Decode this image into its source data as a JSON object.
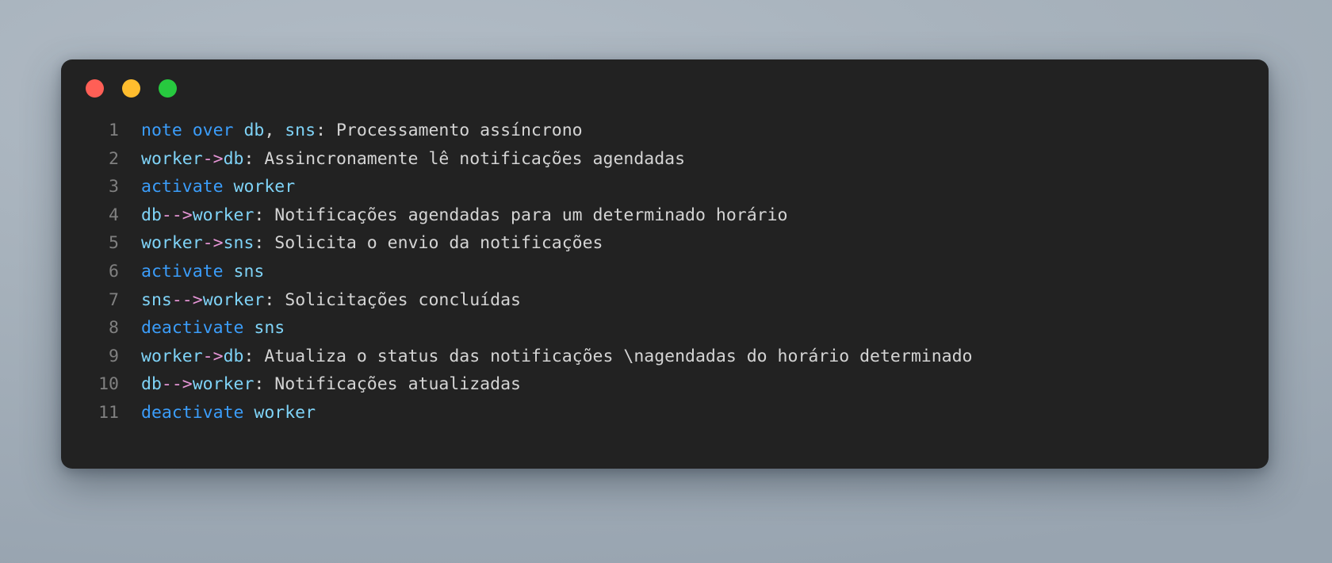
{
  "window": {
    "background_color": "#222222",
    "desktop_color": "#a6b1bb",
    "traffic_lights": [
      {
        "name": "close",
        "color": "#ff5f56",
        "label": "Close"
      },
      {
        "name": "minimize",
        "color": "#ffbd2e",
        "label": "Minimize"
      },
      {
        "name": "maximize",
        "color": "#27c93f",
        "label": "Maximize"
      }
    ]
  },
  "editor": {
    "language": "sequence-diagram",
    "colors": {
      "keyword": "#3b9dfa",
      "actor": "#7fd3f7",
      "arrow": "#e695d6",
      "text": "#d4d4d4",
      "gutter": "#808080"
    },
    "lines": [
      {
        "number": "1",
        "plain": "note over db, sns: Processamento assíncrono",
        "tokens": [
          {
            "t": "note over ",
            "c": "keyword"
          },
          {
            "t": "db",
            "c": "actor"
          },
          {
            "t": ", ",
            "c": "punct"
          },
          {
            "t": "sns",
            "c": "actor"
          },
          {
            "t": ": Processamento assíncrono",
            "c": "text"
          }
        ]
      },
      {
        "number": "2",
        "plain": "worker->db: Assincronamente lê notificações agendadas",
        "tokens": [
          {
            "t": "worker",
            "c": "actor"
          },
          {
            "t": "->",
            "c": "arrow"
          },
          {
            "t": "db",
            "c": "actor"
          },
          {
            "t": ": Assincronamente lê notificações agendadas",
            "c": "text"
          }
        ]
      },
      {
        "number": "3",
        "plain": "activate worker",
        "tokens": [
          {
            "t": "activate ",
            "c": "keyword"
          },
          {
            "t": "worker",
            "c": "actor"
          }
        ]
      },
      {
        "number": "4",
        "plain": "db-->worker: Notificações agendadas para um determinado horário",
        "tokens": [
          {
            "t": "db",
            "c": "actor"
          },
          {
            "t": "-->",
            "c": "arrow"
          },
          {
            "t": "worker",
            "c": "actor"
          },
          {
            "t": ": Notificações agendadas para um determinado horário",
            "c": "text"
          }
        ]
      },
      {
        "number": "5",
        "plain": "worker->sns: Solicita o envio da notificações",
        "tokens": [
          {
            "t": "worker",
            "c": "actor"
          },
          {
            "t": "->",
            "c": "arrow"
          },
          {
            "t": "sns",
            "c": "actor"
          },
          {
            "t": ": Solicita o envio da notificações",
            "c": "text"
          }
        ]
      },
      {
        "number": "6",
        "plain": "activate sns",
        "tokens": [
          {
            "t": "activate ",
            "c": "keyword"
          },
          {
            "t": "sns",
            "c": "actor"
          }
        ]
      },
      {
        "number": "7",
        "plain": "sns-->worker: Solicitações concluídas",
        "tokens": [
          {
            "t": "sns",
            "c": "actor"
          },
          {
            "t": "-->",
            "c": "arrow"
          },
          {
            "t": "worker",
            "c": "actor"
          },
          {
            "t": ": Solicitações concluídas",
            "c": "text"
          }
        ]
      },
      {
        "number": "8",
        "plain": "deactivate sns",
        "tokens": [
          {
            "t": "deactivate ",
            "c": "keyword"
          },
          {
            "t": "sns",
            "c": "actor"
          }
        ]
      },
      {
        "number": "9",
        "plain": "worker->db: Atualiza o status das notificações \\nagendadas do horário determinado",
        "tokens": [
          {
            "t": "worker",
            "c": "actor"
          },
          {
            "t": "->",
            "c": "arrow"
          },
          {
            "t": "db",
            "c": "actor"
          },
          {
            "t": ": Atualiza o status das notificações \\nagendadas do horário determinado",
            "c": "text"
          }
        ]
      },
      {
        "number": "10",
        "plain": "db-->worker: Notificações atualizadas",
        "tokens": [
          {
            "t": "db",
            "c": "actor"
          },
          {
            "t": "-->",
            "c": "arrow"
          },
          {
            "t": "worker",
            "c": "actor"
          },
          {
            "t": ": Notificações atualizadas",
            "c": "text"
          }
        ]
      },
      {
        "number": "11",
        "plain": "deactivate worker",
        "tokens": [
          {
            "t": "deactivate ",
            "c": "keyword"
          },
          {
            "t": "worker",
            "c": "actor"
          }
        ]
      }
    ]
  }
}
